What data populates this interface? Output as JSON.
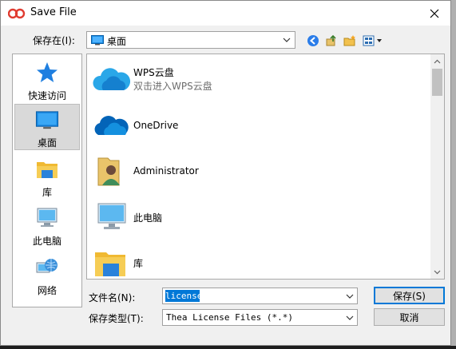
{
  "window": {
    "title": "Save File"
  },
  "lookin": {
    "label": "保存在(I):",
    "value": "桌面"
  },
  "places": [
    {
      "label": "快速访问",
      "icon": "star-icon"
    },
    {
      "label": "桌面",
      "icon": "desktop-icon",
      "selected": true
    },
    {
      "label": "库",
      "icon": "folder-icon"
    },
    {
      "label": "此电脑",
      "icon": "computer-icon"
    },
    {
      "label": "网络",
      "icon": "network-icon"
    }
  ],
  "files": [
    {
      "name": "WPS云盘",
      "sub": "双击进入WPS云盘",
      "icon": "wps-cloud-icon"
    },
    {
      "name": "OneDrive",
      "icon": "onedrive-icon"
    },
    {
      "name": "Administrator",
      "icon": "user-folder-icon"
    },
    {
      "name": "此电脑",
      "icon": "computer-icon"
    },
    {
      "name": "库",
      "icon": "library-icon"
    }
  ],
  "filename": {
    "label": "文件名(N):",
    "value": "license"
  },
  "filetype": {
    "label": "保存类型(T):",
    "value": "Thea License Files (*.*)"
  },
  "buttons": {
    "save": "保存(S)",
    "cancel": "取消"
  },
  "colors": {
    "accent": "#0078d7",
    "selection": "#d9d9d9"
  }
}
